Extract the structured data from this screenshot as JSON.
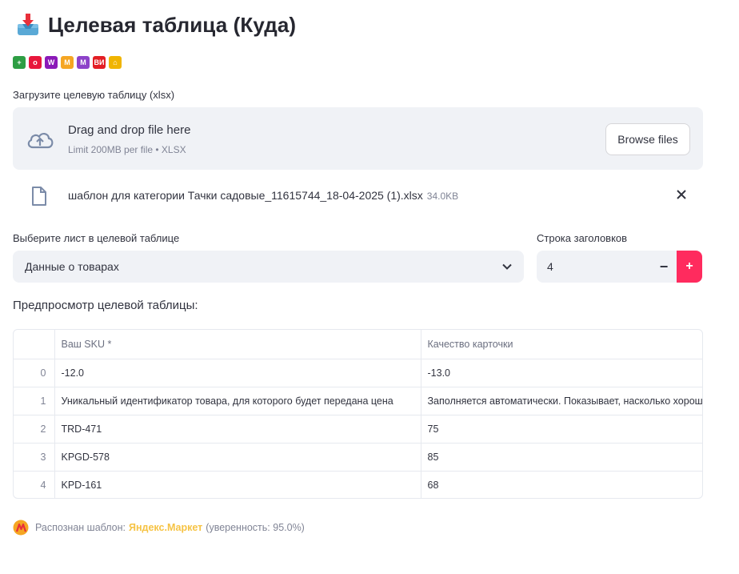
{
  "header": {
    "icon": "inbox-tray-icon",
    "title": "Целевая таблица (Куда)"
  },
  "marketplaces": [
    {
      "name": "plus-icon",
      "glyph": "+",
      "color": "#2e9e44"
    },
    {
      "name": "ozon-icon",
      "glyph": "o",
      "color": "#e8173c"
    },
    {
      "name": "wildberries-icon",
      "glyph": "W",
      "color": "#8b1ab8"
    },
    {
      "name": "yandex-market-icon",
      "glyph": "M",
      "color": "#f5a623"
    },
    {
      "name": "megamarket-icon",
      "glyph": "M",
      "color": "#8d42c9"
    },
    {
      "name": "vseinstrumenti-icon",
      "glyph": "ВИ",
      "color": "#e31e24"
    },
    {
      "name": "home-icon",
      "glyph": "⌂",
      "color": "#f0b400"
    }
  ],
  "uploader": {
    "label": "Загрузите целевую таблицу (xlsx)",
    "title": "Drag and drop file here",
    "subtitle": "Limit 200MB per file • XLSX",
    "browse_label": "Browse files"
  },
  "file": {
    "name": "шаблон для категории Тачки садовые_11615744_18-04-2025 (1).xlsx",
    "size": "34.0KB"
  },
  "sheet_select": {
    "label": "Выберите лист в целевой таблице",
    "value": "Данные о товарах"
  },
  "header_row": {
    "label": "Строка заголовков",
    "value": "4",
    "minus": "−",
    "plus": "+"
  },
  "preview": {
    "title": "Предпросмотр целевой таблицы:",
    "columns": [
      "",
      "Ваш SKU *",
      "Качество карточки"
    ],
    "rows": [
      [
        "0",
        "-12.0",
        "-13.0"
      ],
      [
        "1",
        "Уникальный идентификатор товара, для которого будет передана цена",
        "Заполняется автоматически. Показывает, насколько хорошо заполнена карточка"
      ],
      [
        "2",
        "TRD-471",
        "75"
      ],
      [
        "3",
        "KPGD-578",
        "85"
      ],
      [
        "4",
        "KPD-161",
        "68"
      ]
    ]
  },
  "status": {
    "prefix": "Распознан шаблон:",
    "template": "Яндекс.Маркет",
    "suffix": "(уверенность: 95.0%)"
  }
}
